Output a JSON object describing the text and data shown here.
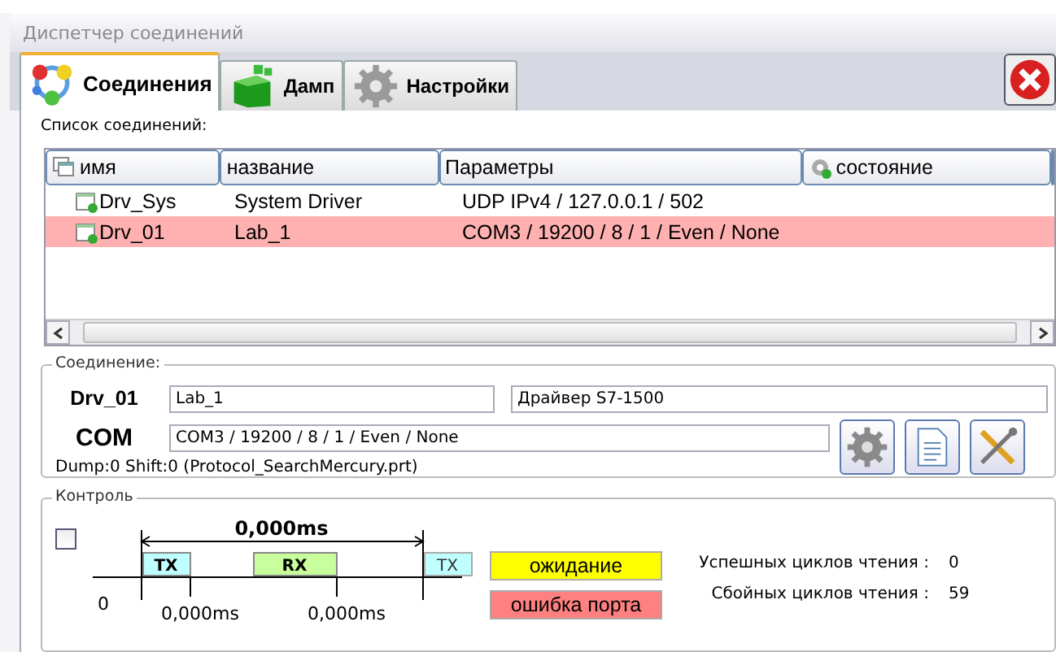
{
  "window": {
    "title": "Диспетчер соединений"
  },
  "tabs": [
    {
      "label": "Соединения",
      "selected": true
    },
    {
      "label": "Дамп",
      "selected": false
    },
    {
      "label": "Настройки",
      "selected": false
    }
  ],
  "list": {
    "label": "Список соединений:",
    "columns": [
      "имя",
      "название",
      "Параметры",
      "состояние"
    ],
    "rows": [
      {
        "name": "Drv_Sys",
        "title": "System Driver",
        "params": "UDP IPv4 / 127.0.0.1 / 502",
        "selected": false
      },
      {
        "name": "Drv_01",
        "title": "Lab_1",
        "params": "COM3 / 19200 / 8 / 1 / Even / None",
        "selected": true
      }
    ]
  },
  "connection": {
    "label": "Соединение:",
    "name": "Drv_01",
    "title": "Lab_1",
    "driver": "Драйвер S7-1500",
    "type": "COM",
    "params": "COM3 / 19200 / 8 / 1 / Even / None",
    "info": "Dump:0  Shift:0  (Protocol_SearchMercury.prt)"
  },
  "control": {
    "label": "Контроль",
    "checked": false,
    "timing": {
      "period": "0,000ms",
      "tx": "TX",
      "rx": "RX",
      "tx_next": "TX",
      "zero": "0",
      "t1": "0,000ms",
      "t2": "0,000ms"
    },
    "statuses": [
      {
        "label": "ожидание",
        "color": "#ffff00"
      },
      {
        "label": "ошибка порта",
        "color": "#ff8080"
      }
    ],
    "stats": [
      {
        "label": "Успешных циклов чтения :",
        "value": "0"
      },
      {
        "label": "Сбойных циклов чтения :",
        "value": "59"
      }
    ]
  }
}
